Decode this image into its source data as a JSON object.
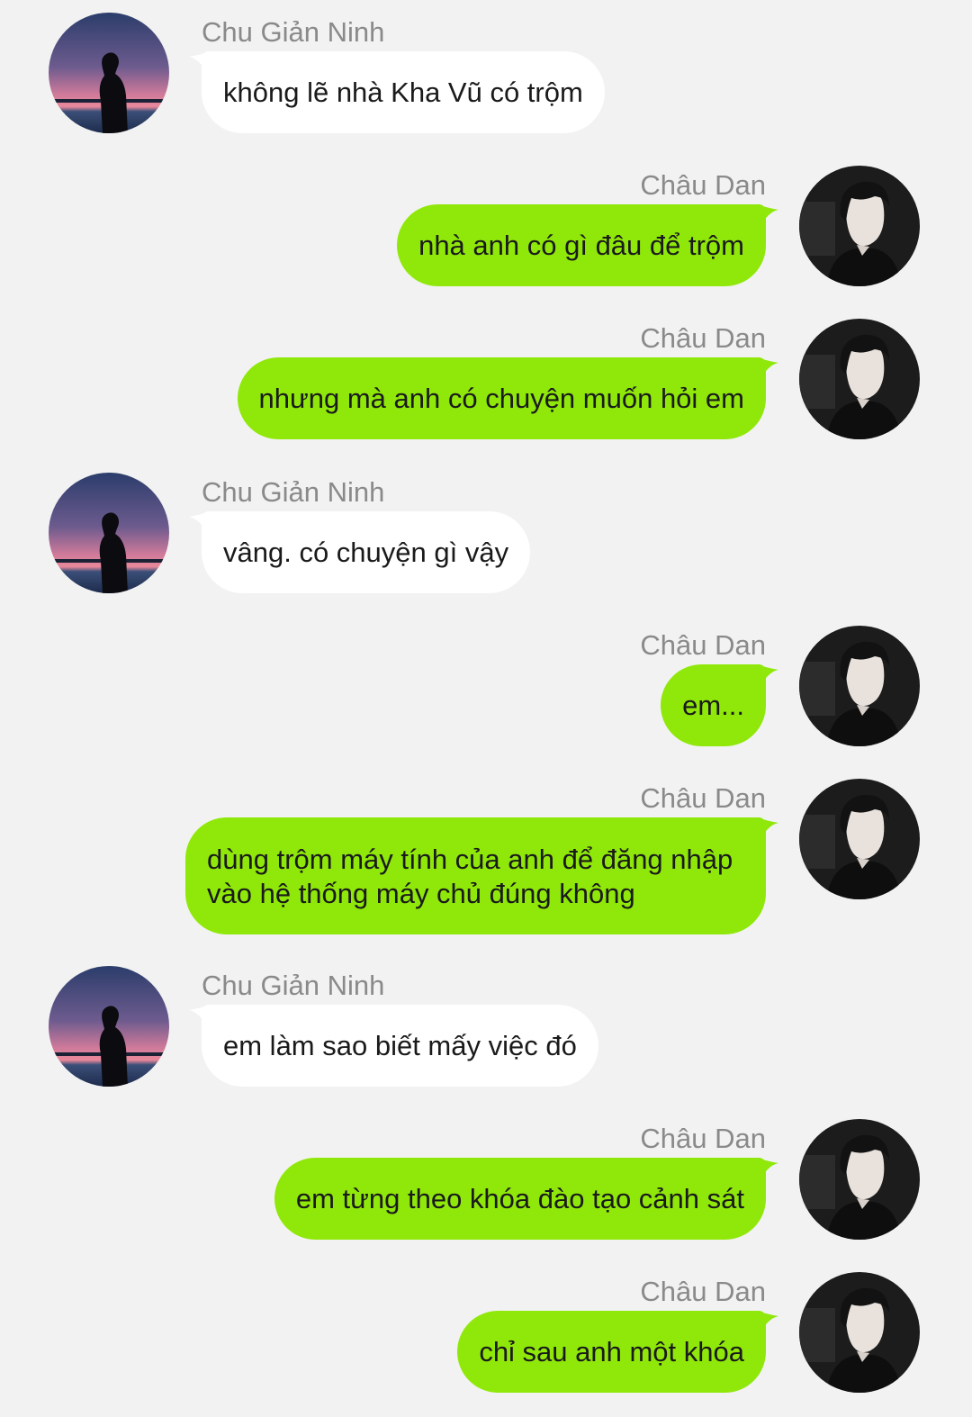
{
  "colors": {
    "background": "#f2f2f2",
    "incoming_bubble": "#ffffff",
    "outgoing_bubble": "#8fe80a",
    "sender_name": "#8a8a8a",
    "message_text": "#1a1a1a"
  },
  "contacts": {
    "left": {
      "name": "Chu Giản Ninh",
      "avatar_icon": "silhouette-sunset-avatar"
    },
    "right": {
      "name": "Châu Dan",
      "avatar_icon": "dark-portrait-avatar"
    }
  },
  "messages": [
    {
      "side": "left",
      "sender": "Chu Giản Ninh",
      "text": "không lẽ nhà Kha Vũ có trộm"
    },
    {
      "side": "right",
      "sender": "Châu Dan",
      "text": "nhà anh có gì đâu để trộm"
    },
    {
      "side": "right",
      "sender": "Châu Dan",
      "text": "nhưng mà anh có chuyện muốn hỏi em"
    },
    {
      "side": "left",
      "sender": "Chu Giản Ninh",
      "text": "vâng. có chuyện gì vậy"
    },
    {
      "side": "right",
      "sender": "Châu Dan",
      "text": "em..."
    },
    {
      "side": "right",
      "sender": "Châu Dan",
      "text": "dùng trộm máy tính của anh để đăng nhập vào hệ thống máy chủ đúng không"
    },
    {
      "side": "left",
      "sender": "Chu Giản Ninh",
      "text": "em làm sao biết mấy việc đó"
    },
    {
      "side": "right",
      "sender": "Châu Dan",
      "text": "em từng theo khóa đào tạo cảnh sát"
    },
    {
      "side": "right",
      "sender": "Châu Dan",
      "text": "chỉ sau anh một khóa"
    }
  ]
}
